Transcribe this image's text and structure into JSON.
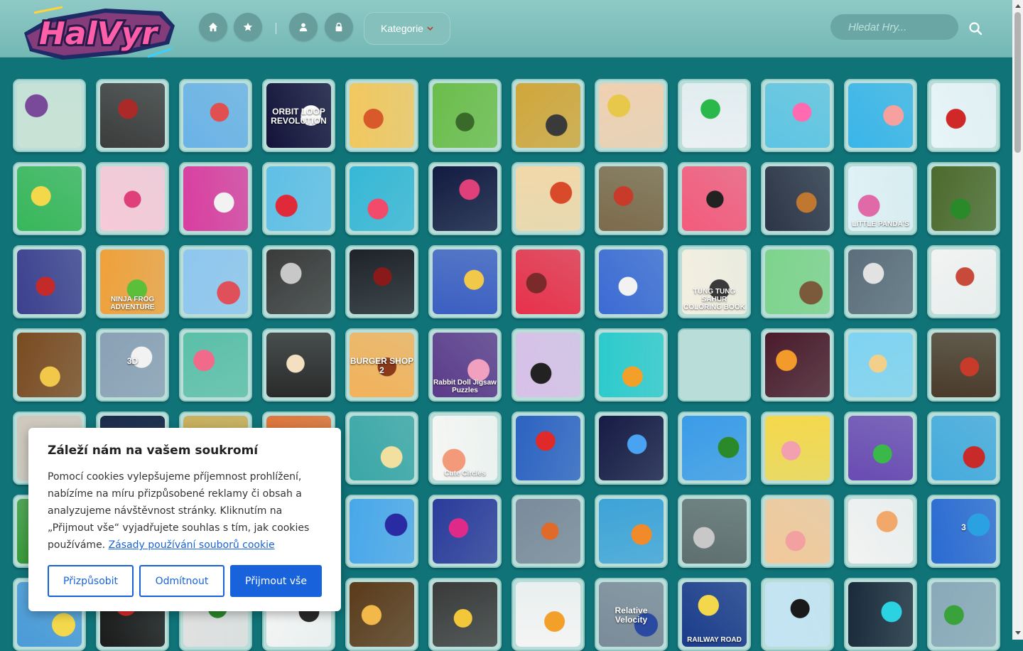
{
  "header": {
    "logo_text": "HalVyr",
    "nav_buttons": [
      "home-icon",
      "star-icon",
      "user-icon",
      "lock-icon"
    ],
    "category_label": "Kategorie",
    "search_placeholder": "Hledat Hry..."
  },
  "colors": {
    "page_background": "#0f7378",
    "header_background": "#80c1bd",
    "cookie_accent": "#1863dc"
  },
  "games": {
    "thumbnail_texts": [
      "ORBIT LOOP REVOLUTION",
      "NINJA FROG ADVENTURE",
      "BURGER SHOP 2",
      "Rabbit Doll Jigsaw Puzzles",
      "TUNG TUNG SAHUR COLORING BOOK",
      "3D",
      "Cute Circles",
      "Relative Velocity",
      "RAILWAY ROAD",
      "LITTLE PANDA'S",
      "3"
    ]
  },
  "cookie_banner": {
    "title": "Záleží nám na vašem soukromí",
    "body": "Pomocí cookies vylepšujeme příjemnost prohlížení, nabízíme na míru přizpůsobené reklamy či obsah a analyzujeme návštěvnost stránky. Kliknutím na „Přijmout vše“ vyjadřujete souhlas s tím, jak cookies používáme.",
    "policy_link": "Zásady používání souborů cookie",
    "buttons": {
      "customize": "Přizpůsobit",
      "reject": "Odmítnout",
      "accept": "Přijmout vše"
    }
  }
}
